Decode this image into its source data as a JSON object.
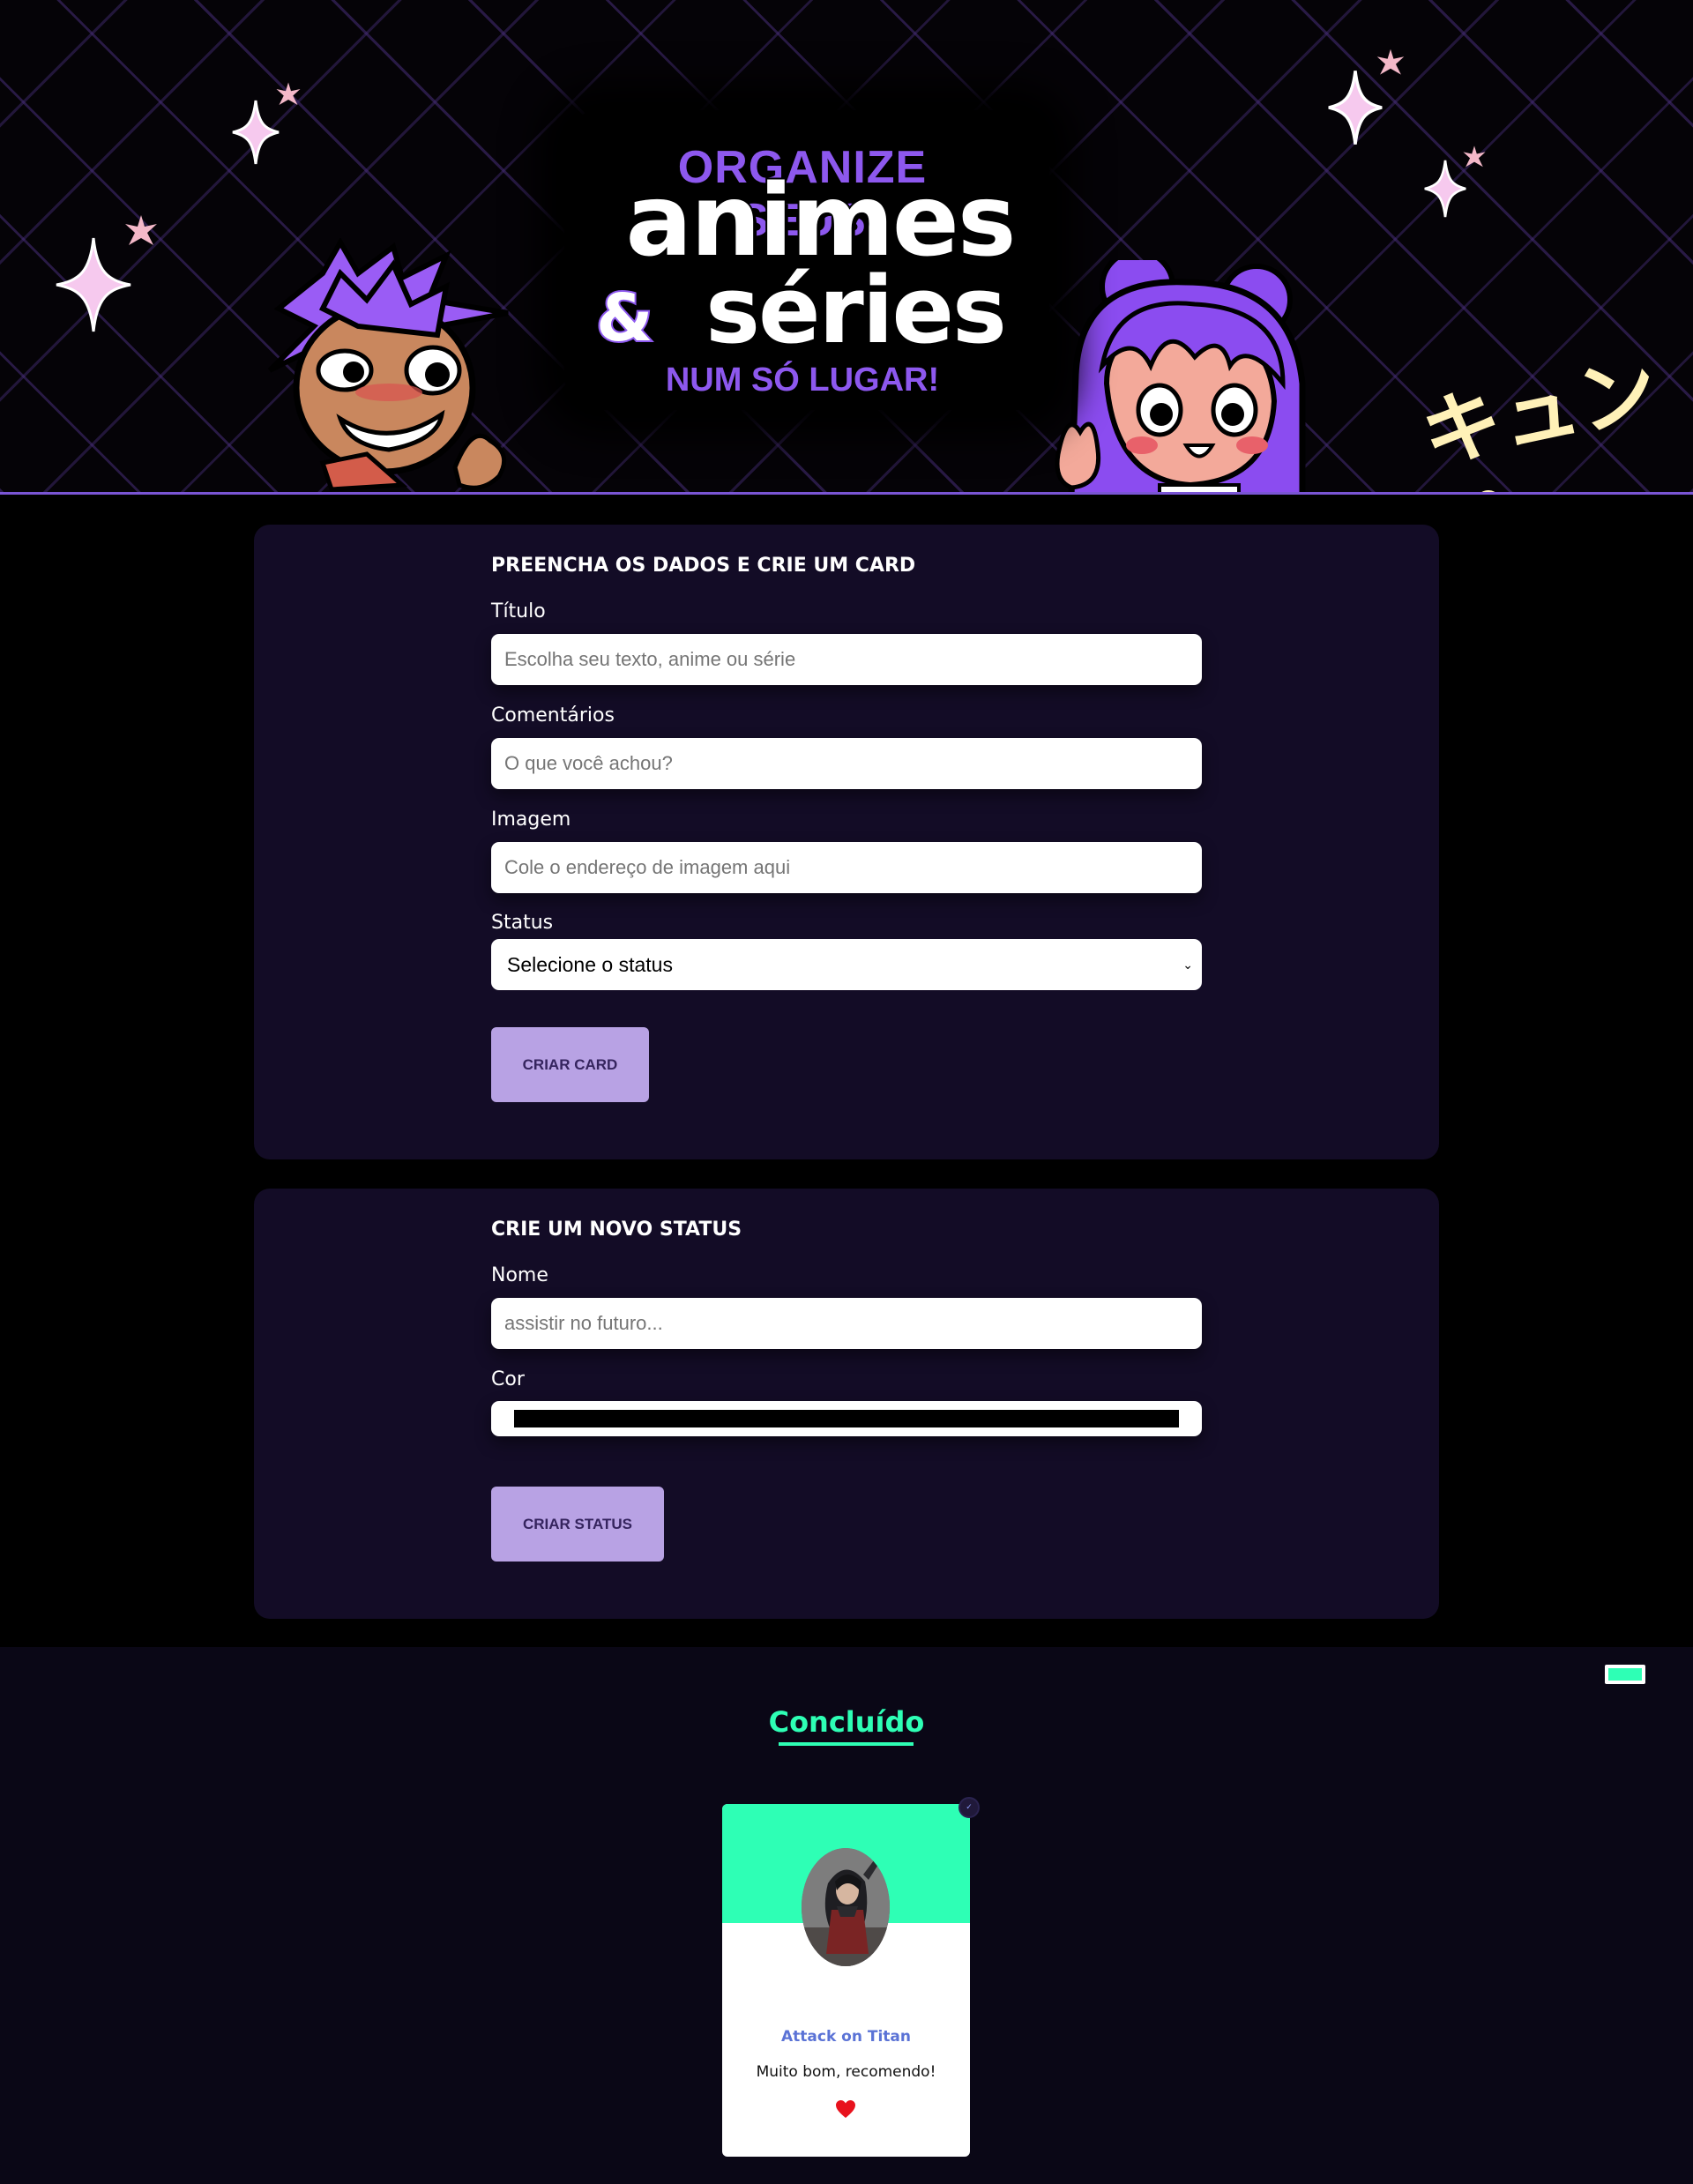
{
  "header": {
    "logo_line1": "ORGANIZE SEUS",
    "logo_line2": "animes",
    "logo_amp": "&",
    "logo_line3": "séries",
    "logo_line4": "NUM SÓ LUGAR!",
    "kyun_text": "キュン♡",
    "accent_color": "#8d58ee",
    "line_color": "#7a55d4"
  },
  "card_form": {
    "title": "PREENCHA OS DADOS E CRIE UM CARD",
    "titulo_label": "Título",
    "titulo_placeholder": "Escolha seu texto, anime ou série",
    "comentarios_label": "Comentários",
    "comentarios_placeholder": "O que você achou?",
    "imagem_label": "Imagem",
    "imagem_placeholder": "Cole o endereço de imagem aqui",
    "status_label": "Status",
    "status_selected": "Selecione o status",
    "submit_label": "CRIAR CARD"
  },
  "status_form": {
    "title": "CRIE UM NOVO STATUS",
    "nome_label": "Nome",
    "nome_placeholder": "assistir no futuro...",
    "cor_label": "Cor",
    "cor_value": "#000000",
    "submit_label": "CRIAR STATUS"
  },
  "status_list": [
    {
      "name": "Concluído",
      "color": "#2effb5",
      "cards": [
        {
          "title": "Attack on Titan",
          "comment": "Muito bom, recomendo!",
          "favorite": true,
          "icon": "heart-icon"
        }
      ]
    }
  ]
}
